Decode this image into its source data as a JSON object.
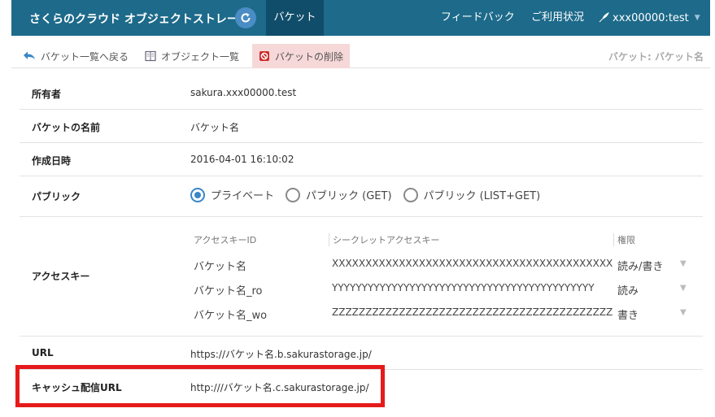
{
  "header": {
    "brand": "さくらのクラウド オブジェクトストレージ：",
    "nav_active": "バケット",
    "feedback": "フィードバック",
    "usage": "ご利用状況",
    "user": "xxx00000:test"
  },
  "toolbar": {
    "back_label": "バケット一覧へ戻る",
    "objects_label": "オブジェクト一覧",
    "delete_label": "バケットの削除",
    "title": "バケット: バケット名"
  },
  "details": {
    "owner_label": "所有者",
    "owner_value": "sakura.xxx00000.test",
    "name_label": "バケットの名前",
    "name_value": "バケット名",
    "created_label": "作成日時",
    "created_value": "2016-04-01 16:10:02",
    "public_label": "パブリック",
    "public_options": [
      "プライベート",
      "パブリック (GET)",
      "パブリック (LIST+GET)"
    ],
    "public_selected": "プライベート",
    "access_key_label": "アクセスキー",
    "url_label": "URL",
    "url_value": "https://バケット名.b.sakurastorage.jp/",
    "cache_url_label": "キャッシュ配信URL",
    "cache_url_value": "http:///バケット名.c.sakurastorage.jp/"
  },
  "access_keys": {
    "headers": [
      "アクセスキーID",
      "シークレットアクセスキー",
      "権限"
    ],
    "rows": [
      {
        "id": "バケット名",
        "secret": "XXXXXXXXXXXXXXXXXXXXXXXXXXXXXXXXXXXXXXXXXXX",
        "perm": "読み/書き"
      },
      {
        "id": "バケット名_ro",
        "secret": "YYYYYYYYYYYYYYYYYYYYYYYYYYYYYYYYYYYYYYYYYYYY",
        "perm": "読み"
      },
      {
        "id": "バケット名_wo",
        "secret": "ZZZZZZZZZZZZZZZZZZZZZZZZZZZZZZZZZZZZZZZZZZZZ",
        "perm": "書き"
      }
    ]
  },
  "colors": {
    "header_bg": "#1d6a8a",
    "header_active": "#104d6a",
    "radio_selected": "#3a86c8",
    "highlight_border": "#e51b1b",
    "delete_bg": "#f7d8d8"
  }
}
